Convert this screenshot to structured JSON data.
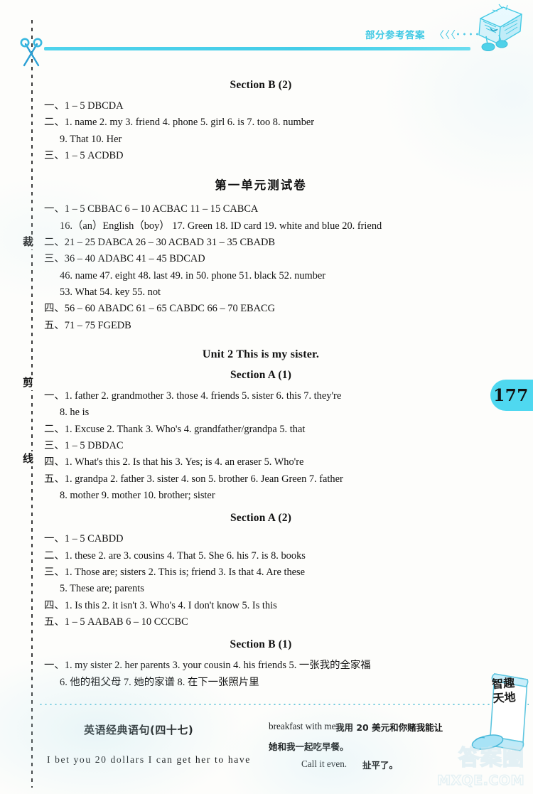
{
  "header": {
    "title": "部分参考答案",
    "chevrons": "〈〈〈",
    "mascot_icon": "book-mascot-icon"
  },
  "cutline": {
    "chars": [
      "裁",
      "剪",
      "线"
    ],
    "scissors_icon": "scissors-icon"
  },
  "page_number": "177",
  "content": [
    {
      "kind": "section-heading",
      "text": "Section B (2)"
    },
    {
      "kind": "answer",
      "text": "一、1 – 5 DBCDA"
    },
    {
      "kind": "answer",
      "text": "二、1. name  2. my  3. friend  4. phone  5. girl  6. is  7. too  8. number"
    },
    {
      "kind": "answer-indent",
      "text": "9. That   10. Her"
    },
    {
      "kind": "answer",
      "text": "三、1 – 5 ACDBD"
    },
    {
      "kind": "chapter-heading",
      "text": "第一单元测试卷"
    },
    {
      "kind": "answer",
      "text": "一、1 – 5 CBBAC   6 – 10 ACBAC   11 – 15 CABCA"
    },
    {
      "kind": "answer-indent",
      "text": "16.（an）English（boy）  17. Green   18. ID card  19. white and blue    20. friend"
    },
    {
      "kind": "answer",
      "text": "二、21 – 25 DABCA    26 – 30 ACBAD   31 – 35 CBADB"
    },
    {
      "kind": "answer",
      "text": "三、36 – 40 ADABC   41 – 45 BDCAD"
    },
    {
      "kind": "answer-indent",
      "text": "46. name   47. eight   48. last   49. in   50. phone   51. black   52. number"
    },
    {
      "kind": "answer-indent",
      "text": "53. What   54. key   55. not"
    },
    {
      "kind": "answer",
      "text": "四、56 – 60 ABADC   61 – 65 CABDC   66 – 70 EBACG"
    },
    {
      "kind": "answer",
      "text": "五、71 – 75 FGEDB"
    },
    {
      "kind": "unit-heading",
      "text": "Unit 2    This is my sister."
    },
    {
      "kind": "section-heading",
      "text": "Section A (1)"
    },
    {
      "kind": "answer",
      "text": "一、1. father  2. grandmother  3. those  4. friends  5. sister  6. this  7. they're"
    },
    {
      "kind": "answer-indent",
      "text": "8. he is"
    },
    {
      "kind": "answer",
      "text": "二、1. Excuse  2. Thank  3. Who's  4. grandfather/grandpa  5. that"
    },
    {
      "kind": "answer",
      "text": "三、1 – 5 DBDAC"
    },
    {
      "kind": "answer",
      "text": "四、1. What's this  2. Is that his  3. Yes; is  4. an eraser  5. Who're"
    },
    {
      "kind": "answer",
      "text": "五、1. grandpa  2. father  3. sister  4. son  5. brother  6. Jean Green  7. father"
    },
    {
      "kind": "answer-indent",
      "text": "8. mother  9. mother   10. brother; sister"
    },
    {
      "kind": "section-heading",
      "text": "Section A (2)"
    },
    {
      "kind": "answer",
      "text": "一、1 – 5 CABDD"
    },
    {
      "kind": "answer",
      "text": "二、1. these  2. are  3. cousins  4. That  5. She  6. his  7. is  8. books"
    },
    {
      "kind": "answer",
      "text": "三、1. Those are; sisters  2. This is; friend  3. Is that  4. Are these"
    },
    {
      "kind": "answer-indent",
      "text": "5. These are; parents"
    },
    {
      "kind": "answer",
      "text": "四、1. Is this  2. it isn't  3. Who's  4. I don't know  5. Is this"
    },
    {
      "kind": "answer",
      "text": "五、1 – 5 AABAB   6 – 10 CCCBC"
    },
    {
      "kind": "section-heading",
      "text": "Section B (1)"
    },
    {
      "kind": "answer",
      "text": "一、1. my sister  2. her parents  3. your cousin  4. his friends  5. 一张我的全家福"
    },
    {
      "kind": "answer-indent",
      "text": "6. 他的祖父母   7. 她的家谱   8. 在下一张照片里"
    }
  ],
  "footer": {
    "title": "英语经典语句(四十七)",
    "english_left": "I  bet  you  20  dollars  I  can  get  her  to  have",
    "english_right": "breakfast with me.",
    "chinese_1": "我用 20 美元和你赌我能让",
    "chinese_2": "她和我一起吃早餐。",
    "english_2": "Call it even.",
    "chinese_3": "扯平了。"
  },
  "scroll_decoration": {
    "text": "智趣天地",
    "icon": "scroll-icon"
  },
  "watermark": {
    "chinese": "答案圈",
    "english": "MXQE.COM"
  },
  "colors": {
    "accent_cyan": "#4fd3ec",
    "badge_cyan": "#4fd8f0",
    "header_text": "#3fc9e4",
    "body_text": "#121212",
    "page_bg": "#fdfdfb"
  }
}
